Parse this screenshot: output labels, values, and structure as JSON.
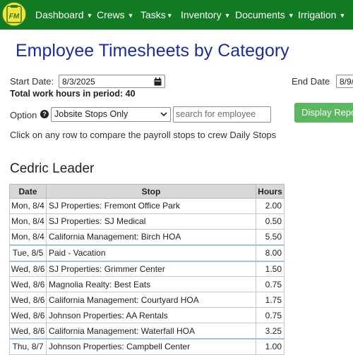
{
  "nav": {
    "logo_text": "FM",
    "items": [
      {
        "label": "Dashboard",
        "caret": "▼"
      },
      {
        "label": "Crews",
        "caret": "▼"
      },
      {
        "label": "Tasks",
        "caret": "▼"
      },
      {
        "label": "Inventory",
        "caret": "▼"
      },
      {
        "label": "Documents",
        "caret": "▼"
      },
      {
        "label": "Irrigation",
        "caret": "▼"
      }
    ]
  },
  "page_title": "Employee Timesheets by Category",
  "filters": {
    "start_label": "Start Date:",
    "start_value": "8/3/2025",
    "end_label": "End Date",
    "end_value": "8/9/",
    "total_text": "Total work hours in period: 40",
    "option_label": "Option",
    "option_value": "Jobsite Stops Only",
    "search_placeholder": "search for employee",
    "display_button": "Display Report",
    "instructions": "Click on any row to compare the payroll stops to crew Daily Stops"
  },
  "employee_name": "Cedric Leader",
  "table": {
    "headers": {
      "date": "Date",
      "stop": "Stop",
      "hours": "Hours"
    },
    "rows": [
      {
        "date": "Mon, 8/4",
        "stop": "SJ Properties: Fremont Office Park",
        "hours": "2.00"
      },
      {
        "date": "Mon, 8/4",
        "stop": "SJ Properties: SJ Medical",
        "hours": "0.50"
      },
      {
        "date": "Mon, 8/4",
        "stop": "California Management: Birch HOA",
        "hours": "5.50"
      },
      {
        "date": "Tue, 8/5",
        "stop": "Paid - Vacation",
        "hours": "8.00"
      },
      {
        "date": "Wed, 8/6",
        "stop": "SJ Properties: Grimmer Center",
        "hours": "1.50"
      },
      {
        "date": "Wed, 8/6",
        "stop": "Magnolia Realty: Best Eats",
        "hours": "0.75"
      },
      {
        "date": "Wed, 8/6",
        "stop": "California Management: Courtyard HOA",
        "hours": "1.75"
      },
      {
        "date": "Wed, 8/6",
        "stop": "Johnson Properties: AA Rentals",
        "hours": "0.75"
      },
      {
        "date": "Wed, 8/6",
        "stop": "California Management: Waterfall HOA",
        "hours": "3.25"
      },
      {
        "date": "Thu, 8/7",
        "stop": "Johnson Properties: Campbell Center",
        "hours": "1.00"
      }
    ]
  },
  "colors": {
    "nav_bg": "#117a22",
    "title": "#1a2d9c",
    "button": "#5cb860",
    "logo_bg": "#f3e33a",
    "day_separator": "#9ec3e6"
  }
}
